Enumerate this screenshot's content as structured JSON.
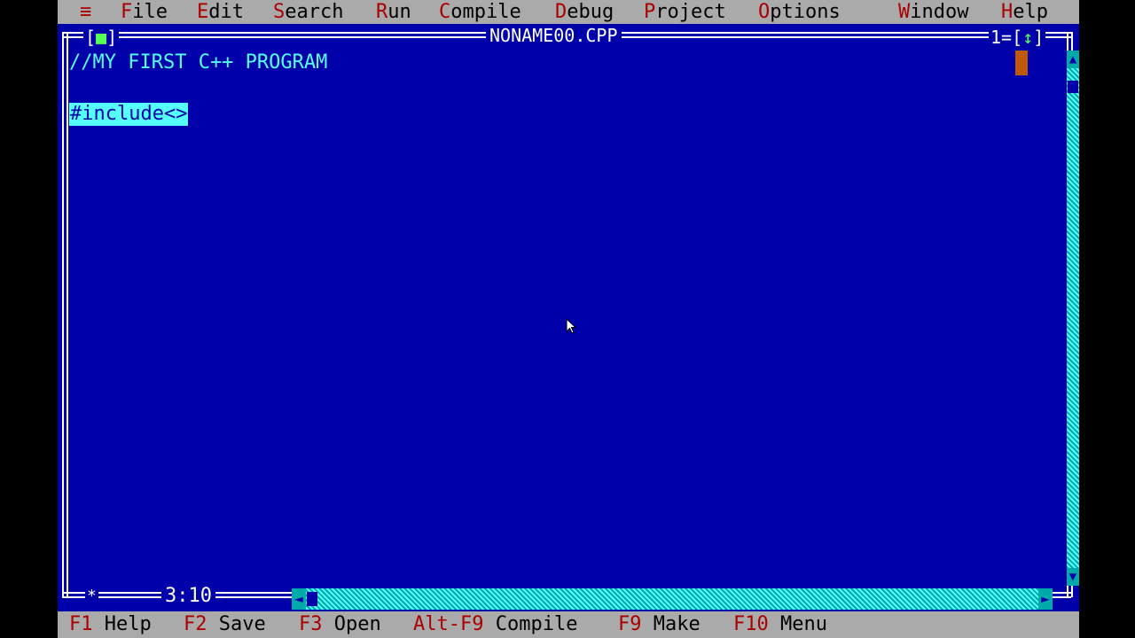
{
  "menu": {
    "system": "≡",
    "items": [
      {
        "hotkey": "F",
        "rest": "ile"
      },
      {
        "hotkey": "E",
        "rest": "dit"
      },
      {
        "hotkey": "S",
        "rest": "earch"
      },
      {
        "hotkey": "R",
        "rest": "un"
      },
      {
        "hotkey": "C",
        "rest": "ompile"
      },
      {
        "hotkey": "D",
        "rest": "ebug"
      },
      {
        "hotkey": "P",
        "rest": "roject"
      },
      {
        "hotkey": "O",
        "rest": "ptions"
      },
      {
        "hotkey": "W",
        "rest": "indow"
      },
      {
        "hotkey": "H",
        "rest": "elp"
      }
    ]
  },
  "window": {
    "close_box": "[■]",
    "title": "NONAME00.CPP",
    "number": "1",
    "zoom_box": "[↕]",
    "cursor_position": "3:10",
    "modified_marker": "*"
  },
  "editor": {
    "lines": [
      "//MY FIRST C++ PROGRAM",
      "",
      "#include<>"
    ]
  },
  "status": {
    "items": [
      {
        "key": "F1",
        "label": "Help"
      },
      {
        "key": "F2",
        "label": "Save"
      },
      {
        "key": "F3",
        "label": "Open"
      },
      {
        "key": "Alt-F9",
        "label": "Compile"
      },
      {
        "key": "F9",
        "label": "Make"
      },
      {
        "key": "F10",
        "label": "Menu"
      }
    ]
  },
  "colors": {
    "desktop": "#0000AA",
    "menu_bg": "#AAAAAA",
    "hotkey": "#AA0000",
    "comment_text": "#55FFFF",
    "selection": "#55FFFF",
    "caret": "#C05A0A"
  },
  "icons": {
    "system_menu": "hamburger-icon",
    "mouse": "arrow-pointer-icon",
    "scroll_up": "triangle-up-icon",
    "scroll_down": "triangle-down-icon",
    "scroll_left": "triangle-left-icon",
    "scroll_right": "triangle-right-icon"
  }
}
